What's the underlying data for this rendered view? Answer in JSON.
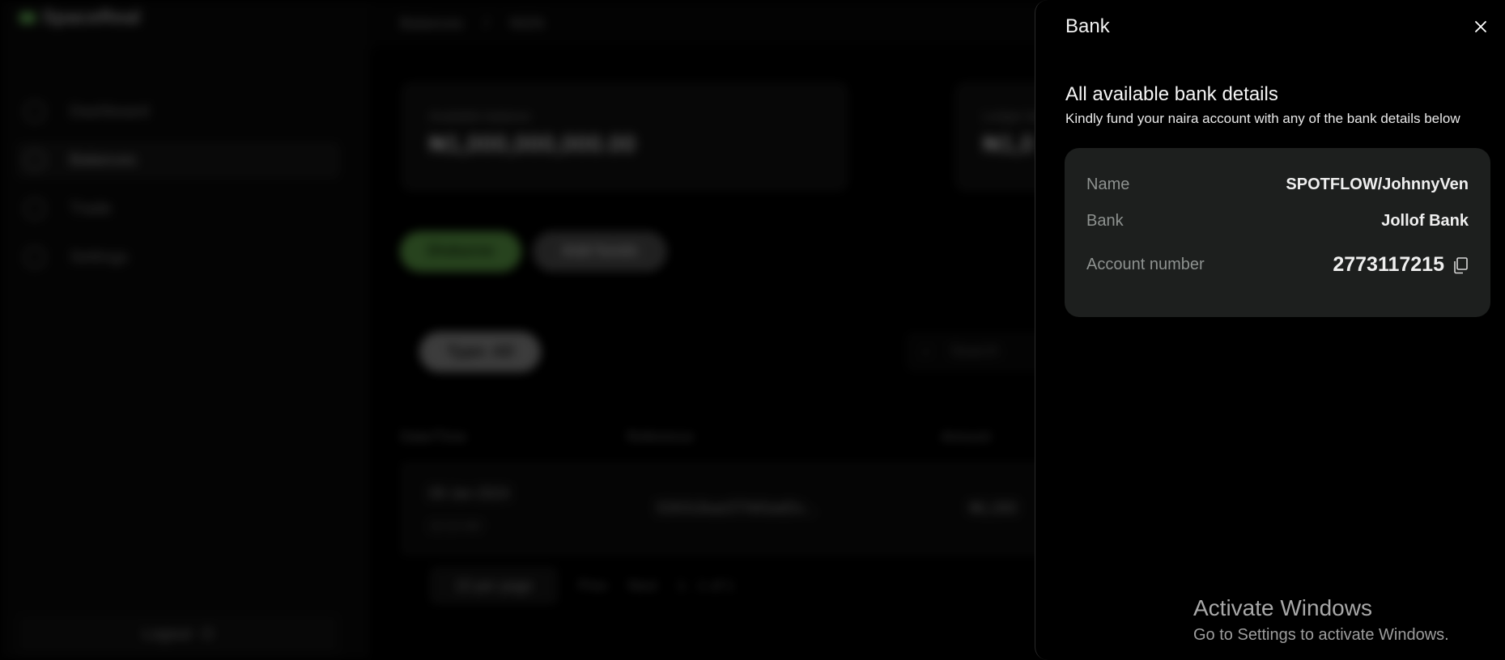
{
  "background_app": {
    "logo_text": "SpaceReal",
    "nav": [
      {
        "label": "Dashboard"
      },
      {
        "label": "Balances"
      },
      {
        "label": "Trade"
      },
      {
        "label": "Settings"
      }
    ],
    "logout_label": "Logout",
    "breadcrumb": [
      "Balances",
      "NGN"
    ],
    "cards": [
      {
        "label": "Available balance",
        "value": "₦1,000,000,000.00"
      },
      {
        "label": "Ledger balance",
        "value": "₦1,0"
      }
    ],
    "actions": {
      "disburse": "Disburse",
      "add_funds": "Add funds"
    },
    "filter": {
      "type": "Type: All"
    },
    "search_placeholder": "Search",
    "table": {
      "headers": [
        "Date/Time",
        "Reference",
        "Amount"
      ],
      "rows": [
        {
          "date": "09 Jan 2024",
          "time": "10:15 AM",
          "reference": "SSKNJkaeSTNKbatDv...",
          "amount": "₦1,000"
        }
      ]
    },
    "pager": {
      "per_page": "10 per page",
      "prev": "Prev",
      "next": "Next",
      "range": "1 - 1 of 1"
    }
  },
  "drawer": {
    "title": "Bank",
    "heading": "All available bank details",
    "subheading": "Kindly fund your naira account with any of the bank details below",
    "details": {
      "name_label": "Name",
      "name_value": "SPOTFLOW/JohnnyVen",
      "bank_label": "Bank",
      "bank_value": "Jollof Bank",
      "account_label": "Account number",
      "account_value": "2773117215"
    },
    "icons": {
      "close": "close-icon",
      "copy": "copy-icon"
    }
  },
  "watermark": {
    "line1": "Activate Windows",
    "line2": "Go to Settings to activate Windows."
  }
}
